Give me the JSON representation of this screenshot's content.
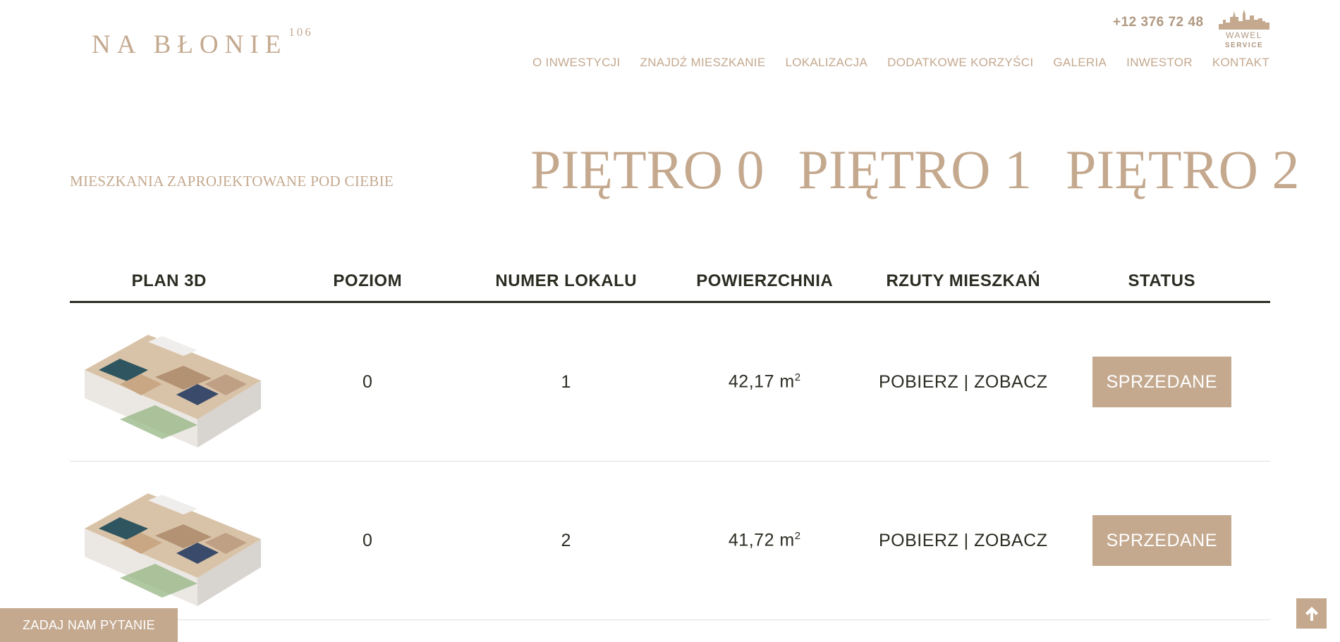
{
  "header": {
    "logo": "NA BŁONIE",
    "logo_sup": "106",
    "phone": "+12 376 72 48",
    "brand_line1": "WAWEL",
    "brand_line2": "SERVICE",
    "brand_icon": "castle-skyline-icon"
  },
  "nav": {
    "items": [
      "O INWESTYCJI",
      "ZNAJDŹ MIESZKANIE",
      "LOKALIZACJA",
      "DODATKOWE KORZYŚCI",
      "GALERIA",
      "INWESTOR",
      "KONTAKT"
    ]
  },
  "section": {
    "subtitle": "MIESZKANIA ZAPROJEKTOWANE POD CIEBIE",
    "floors": [
      "PIĘTRO 0",
      "PIĘTRO 1",
      "PIĘTRO 2"
    ]
  },
  "table": {
    "headers": [
      "PLAN 3D",
      "POZIOM",
      "NUMER LOKALU",
      "POWIERZCHNIA",
      "RZUTY MIESZKAŃ",
      "STATUS"
    ],
    "rows": [
      {
        "level": "0",
        "number": "1",
        "area": "42,17 m",
        "area_unit_sup": "2",
        "download": "POBIERZ",
        "separator": " | ",
        "view": "ZOBACZ",
        "status": "SPRZEDANE"
      },
      {
        "level": "0",
        "number": "2",
        "area": "41,72 m",
        "area_unit_sup": "2",
        "download": "POBIERZ",
        "separator": " | ",
        "view": "ZOBACZ",
        "status": "SPRZEDANE"
      }
    ]
  },
  "floating": {
    "ask_label": "ZADAJ NAM PYTANIE",
    "to_top_icon": "arrow-up-icon"
  },
  "colors": {
    "accent": "#c4a98f",
    "text_dark": "#2a2d22",
    "row_border": "#e4e1dc"
  }
}
